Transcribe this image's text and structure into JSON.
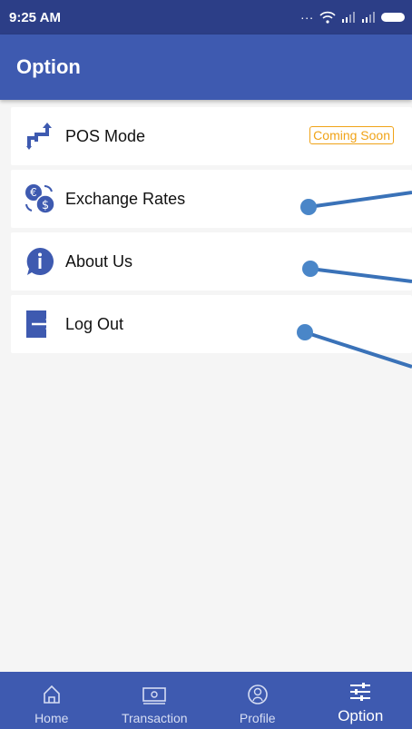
{
  "status_bar": {
    "time": "9:25 AM",
    "dots": "..."
  },
  "app_bar": {
    "title": "Option"
  },
  "menu": {
    "items": [
      {
        "label": "POS Mode",
        "icon": "swap-arrows-icon",
        "badge": "Coming Soon"
      },
      {
        "label": "Exchange Rates",
        "icon": "currency-exchange-icon"
      },
      {
        "label": "About Us",
        "icon": "info-icon"
      },
      {
        "label": "Log Out",
        "icon": "logout-icon"
      }
    ]
  },
  "bottom_nav": {
    "items": [
      {
        "label": "Home",
        "icon": "home-icon"
      },
      {
        "label": "Transaction",
        "icon": "banknote-icon"
      },
      {
        "label": "Profile",
        "icon": "profile-icon"
      },
      {
        "label": "Option",
        "icon": "sliders-icon",
        "active": true
      }
    ]
  },
  "colors": {
    "status_bar": "#2c3e87",
    "primary": "#3e5ab0",
    "badge": "#f0a317",
    "background": "#f5f5f5"
  }
}
